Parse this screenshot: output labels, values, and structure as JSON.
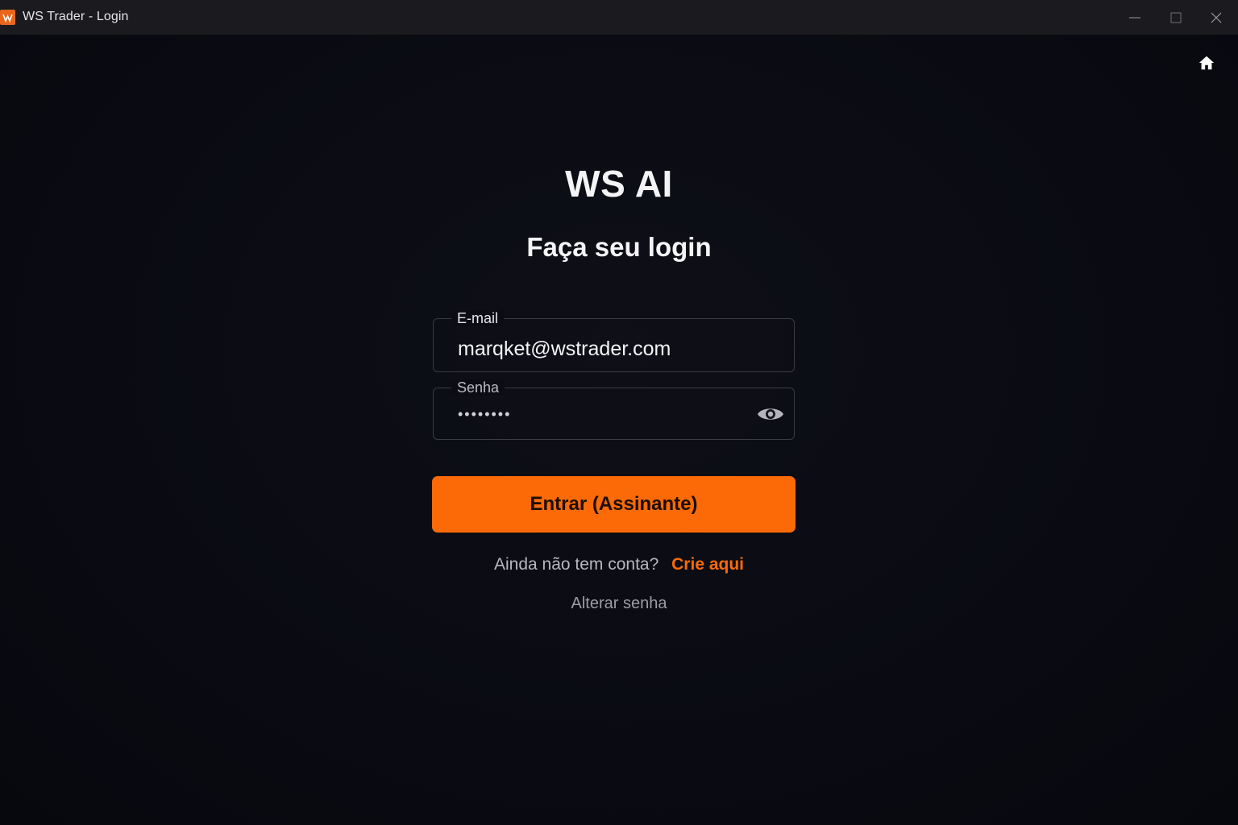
{
  "window": {
    "title": "WS Trader - Login",
    "icon": "ws-trader-logo-icon",
    "controls": [
      "minimize-icon",
      "maximize-icon",
      "close-icon"
    ]
  },
  "header": {
    "home_icon": "home-icon"
  },
  "login": {
    "brand": "WS AI",
    "subtitle": "Faça seu login",
    "email": {
      "label": "E-mail",
      "value": "marqket@wstrader.com"
    },
    "password": {
      "label": "Senha",
      "masked_value": "••••••••",
      "toggle_icon": "eye-icon"
    },
    "submit_label": "Entrar (Assinante)",
    "signup_prompt": "Ainda não tem conta?",
    "signup_link": "Crie aqui",
    "change_password_link": "Alterar senha"
  },
  "colors": {
    "accent": "#fb6a06",
    "background": "#0a0b12",
    "titlebar": "#1b1b1f"
  }
}
